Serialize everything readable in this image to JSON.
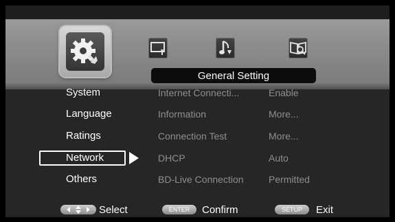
{
  "header": {
    "title": "General Setting",
    "icons": [
      {
        "name": "general-setting-gear-icon",
        "selected": true
      },
      {
        "name": "display-setting-icon",
        "selected": false
      },
      {
        "name": "audio-setting-icon",
        "selected": false
      },
      {
        "name": "information-icon",
        "selected": false
      }
    ]
  },
  "menu": {
    "items": [
      {
        "label": "System"
      },
      {
        "label": "Language"
      },
      {
        "label": "Ratings"
      },
      {
        "label": "Network"
      },
      {
        "label": "Others"
      }
    ],
    "selected_index": 3
  },
  "options": [
    {
      "name": "Internet Connecti...",
      "value": "Enable"
    },
    {
      "name": "Information",
      "value": "More..."
    },
    {
      "name": "Connection Test",
      "value": "More..."
    },
    {
      "name": "DHCP",
      "value": "Auto"
    },
    {
      "name": "BD-Live Connection",
      "value": "Permitted"
    }
  ],
  "hints": {
    "select": "Select",
    "enter_key": "ENTER",
    "confirm": "Confirm",
    "setup_key": "SETUP",
    "exit": "Exit"
  },
  "colors": {
    "background": "#000000",
    "panel": "#262626",
    "band": "#8a8a8a",
    "text": "#ffffff",
    "dim_text": "#8f8f8f"
  }
}
